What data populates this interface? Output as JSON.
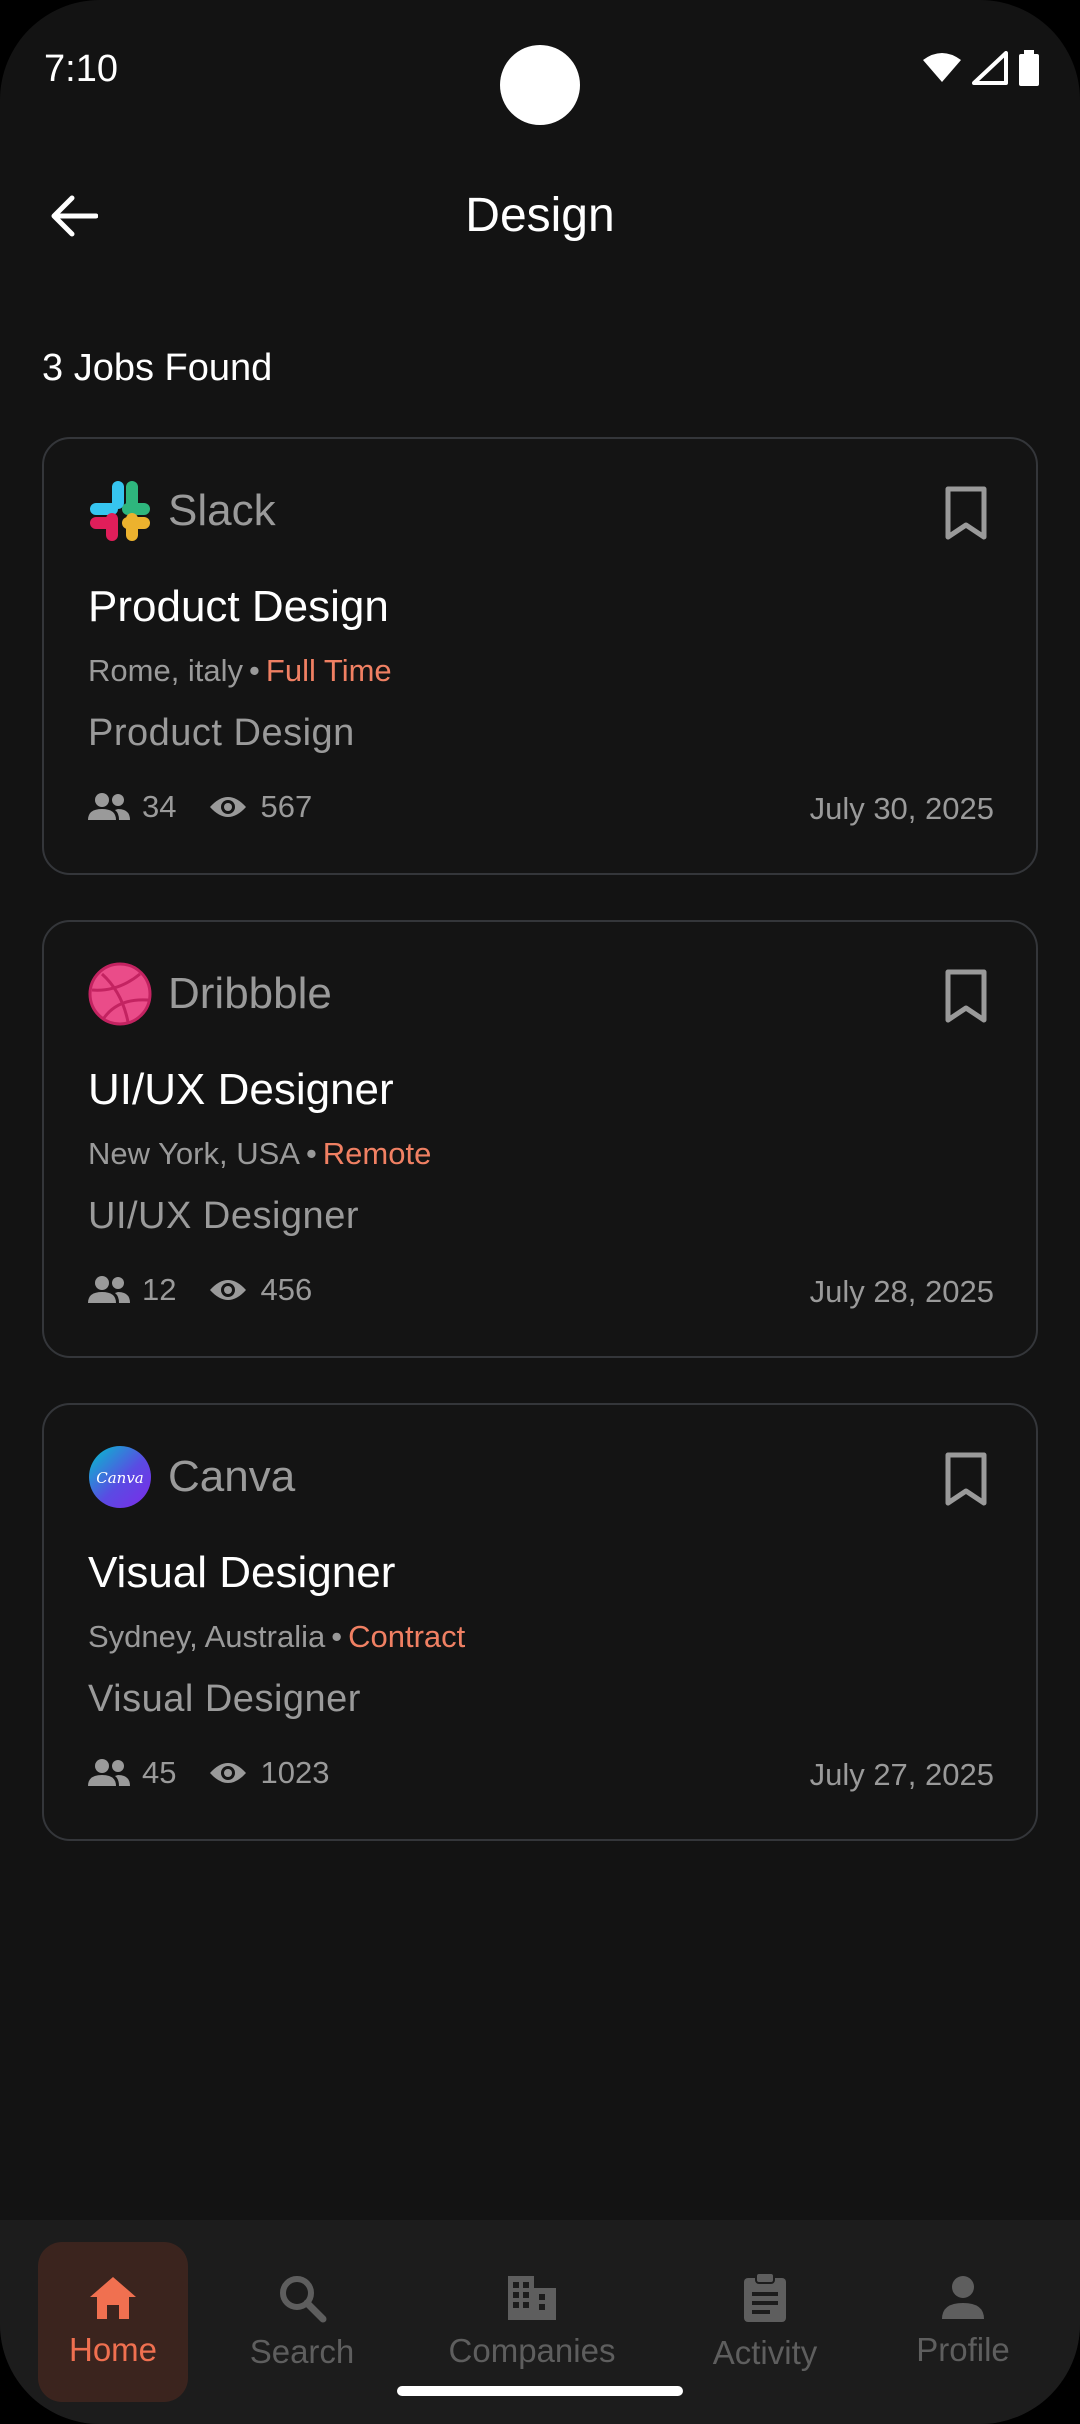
{
  "status_bar": {
    "time": "7:10"
  },
  "header": {
    "title": "Design"
  },
  "jobs_count": "3 Jobs Found",
  "jobs": [
    {
      "company": "Slack",
      "logo_icon": "slack-logo-icon",
      "title": "Product Design",
      "location": "Rome, italy",
      "separator": "•",
      "type": "Full Time",
      "subtitle": "Product Design",
      "applicants": "34",
      "views": "567",
      "date": "July 30, 2025"
    },
    {
      "company": "Dribbble",
      "logo_icon": "dribbble-logo-icon",
      "title": "UI/UX Designer",
      "location": "New York, USA",
      "separator": "•",
      "type": "Remote",
      "subtitle": "UI/UX Designer",
      "applicants": "12",
      "views": "456",
      "date": "July 28, 2025"
    },
    {
      "company": "Canva",
      "logo_icon": "canva-logo-icon",
      "logo_text": "Canva",
      "title": "Visual Designer",
      "location": "Sydney, Australia",
      "separator": "•",
      "type": "Contract",
      "subtitle": "Visual Designer",
      "applicants": "45",
      "views": "1023",
      "date": "July 27, 2025"
    }
  ],
  "bottom_nav": {
    "items": [
      {
        "label": "Home",
        "icon": "home-icon",
        "active": true
      },
      {
        "label": "Search",
        "icon": "search-icon",
        "active": false
      },
      {
        "label": "Companies",
        "icon": "building-icon",
        "active": false
      },
      {
        "label": "Activity",
        "icon": "clipboard-icon",
        "active": false
      },
      {
        "label": "Profile",
        "icon": "person-icon",
        "active": false
      }
    ]
  },
  "colors": {
    "background": "#131313",
    "accent": "#f07050",
    "job_type": "#f08063",
    "muted_text": "#9a9a9a"
  }
}
